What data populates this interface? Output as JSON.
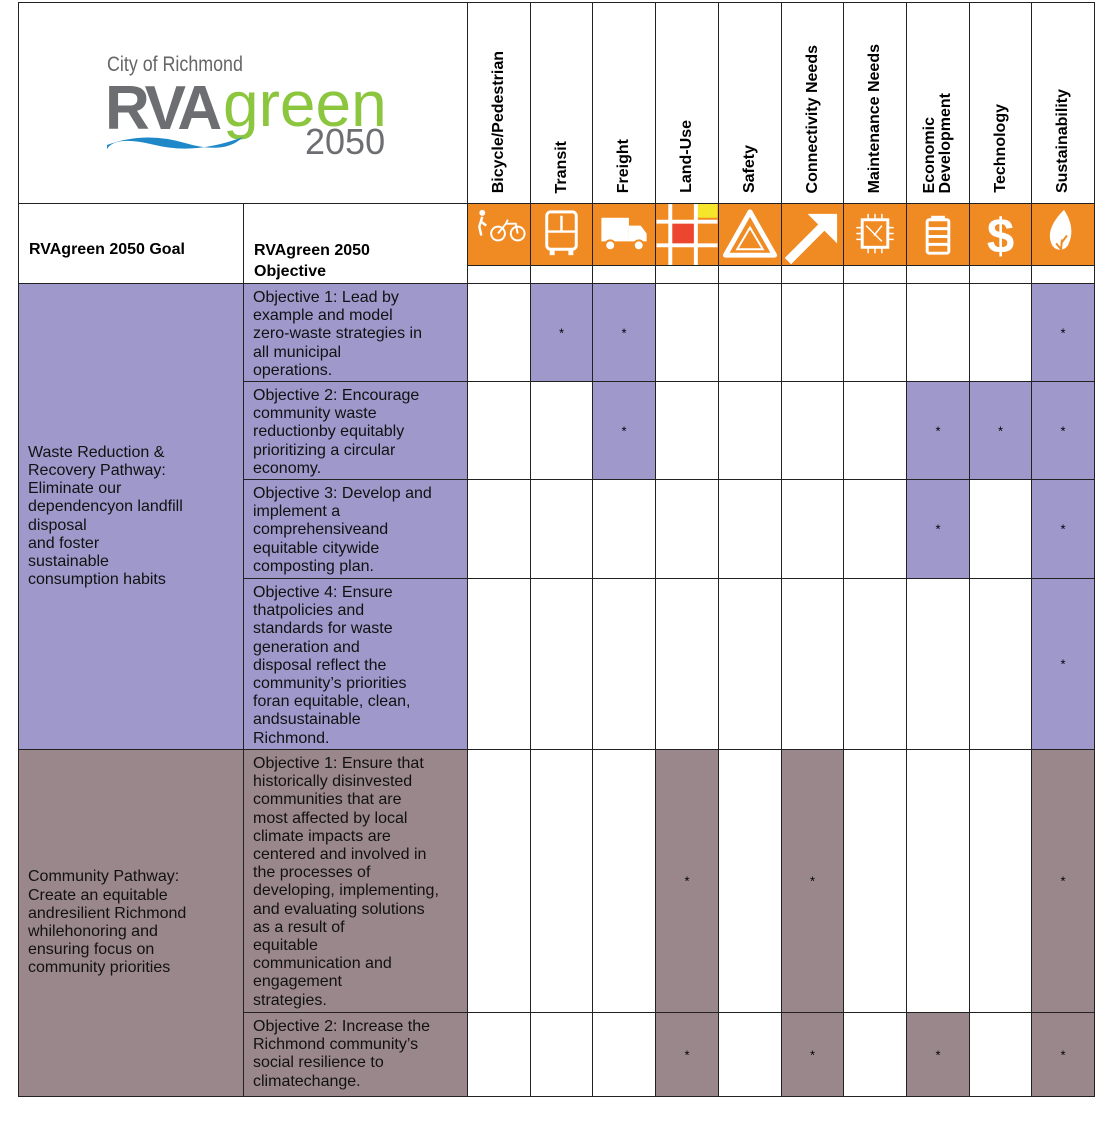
{
  "logo": {
    "city": "City of Richmond",
    "rva": "RVA",
    "green": "green",
    "year": "2050"
  },
  "headers": {
    "goal": "RVAgreen 2050 Goal",
    "objective": "RVAgreen 2050\nObjective"
  },
  "categories": [
    {
      "label": "Bicycle/Pedestrian",
      "icon": "pedestrian-bicycle-icon"
    },
    {
      "label": "Transit",
      "icon": "bus-icon"
    },
    {
      "label": "Freight",
      "icon": "truck-icon"
    },
    {
      "label": "Land-Use",
      "icon": "land-use-grid-icon"
    },
    {
      "label": "Safety",
      "icon": "warning-triangle-icon"
    },
    {
      "label": "Connectivity Needs",
      "icon": "arrow-up-right-icon"
    },
    {
      "label": "Maintenance Needs",
      "icon": "chip-icon"
    },
    {
      "label": "Economic\nDevelopment",
      "icon": "battery-icon"
    },
    {
      "label": "Technology",
      "icon": "dollar-icon"
    },
    {
      "label": "Sustainability",
      "icon": "leaf-icon"
    }
  ],
  "colors": {
    "icon_bg": "#f08a22",
    "waste": "#9e98cb",
    "community": "#9a878b",
    "mark": "*"
  },
  "goals": [
    {
      "text": "Waste Reduction &\nRecovery Pathway:\nEliminate our\ndependencyon landfill\ndisposal\nand foster\nsustainable\nconsumption habits",
      "color": "#9e98cb",
      "objectives": [
        {
          "text": "Objective 1: Lead by\nexample and model\nzero-waste strategies in\nall municipal\noperations.",
          "marks": [
            1,
            2,
            9
          ]
        },
        {
          "text": "Objective 2: Encourage\ncommunity waste\nreductionby equitably\nprioritizing a circular\neconomy.",
          "marks": [
            2,
            7,
            8,
            9
          ]
        },
        {
          "text": "Objective 3: Develop and\nimplement a\ncomprehensiveand\nequitable citywide\ncomposting plan.",
          "marks": [
            7,
            9
          ]
        },
        {
          "text": "Objective 4: Ensure\nthatpolicies and\nstandards for waste\ngeneration and\ndisposal reflect the\ncommunity’s priorities\nforan equitable, clean,\nandsustainable\nRichmond.",
          "marks": [
            9
          ]
        }
      ]
    },
    {
      "text": "Community Pathway:\nCreate an equitable\nandresilient Richmond\nwhilehonoring and\nensuring focus on\ncommunity priorities",
      "color": "#9a878b",
      "objectives": [
        {
          "text": "Objective 1: Ensure that\nhistorically disinvested\ncommunities that are\nmost affected by local\nclimate impacts are\ncentered and involved in\nthe processes of\ndeveloping, implementing,\nand evaluating solutions\nas a result of\nequitable\ncommunication and\nengagement\nstrategies.",
          "marks": [
            3,
            5,
            9
          ]
        },
        {
          "text": "Objective 2: Increase the\nRichmond community’s\nsocial resilience to\nclimatechange.",
          "marks": [
            3,
            5,
            7,
            9
          ]
        }
      ]
    }
  ]
}
